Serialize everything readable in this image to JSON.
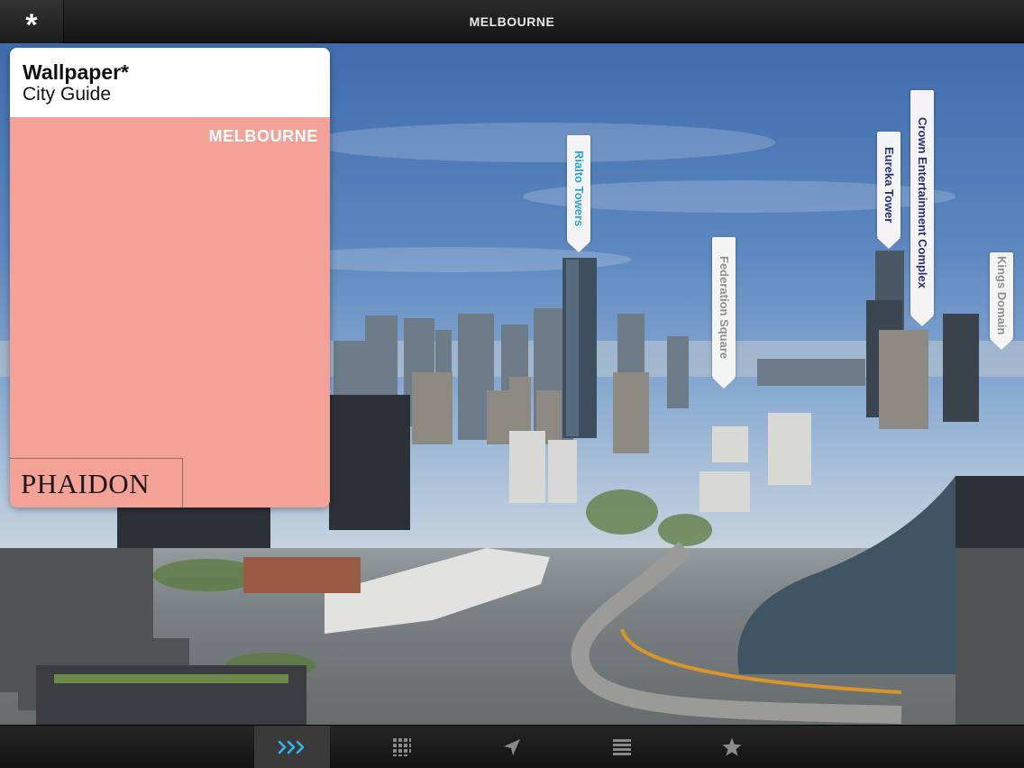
{
  "header": {
    "title": "MELBOURNE",
    "menu_icon_glyph": "*"
  },
  "guide_card": {
    "brand": "Wallpaper*",
    "subtitle": "City Guide",
    "city": "MELBOURNE",
    "publisher": "PHAIDON",
    "color": "#f4a198"
  },
  "landmarks": [
    {
      "label": "Rialto Towers",
      "color": "#2aa2d8"
    },
    {
      "label": "Federation Square",
      "color": "#8f8f8f"
    },
    {
      "label": "Eureka Tower",
      "color": "#2b2f7a"
    },
    {
      "label": "Crown Entertainment Complex",
      "color": "#2b2f7a"
    },
    {
      "label": "Kings Domain",
      "color": "#8f8f8f"
    }
  ],
  "tabbar": {
    "tabs": [
      {
        "icon": "chevrons-right-icon",
        "active": true
      },
      {
        "icon": "grid-icon",
        "active": false
      },
      {
        "icon": "location-arrow-icon",
        "active": false
      },
      {
        "icon": "list-icon",
        "active": false
      },
      {
        "icon": "star-icon",
        "active": false
      }
    ],
    "active_color": "#33b5f0"
  }
}
